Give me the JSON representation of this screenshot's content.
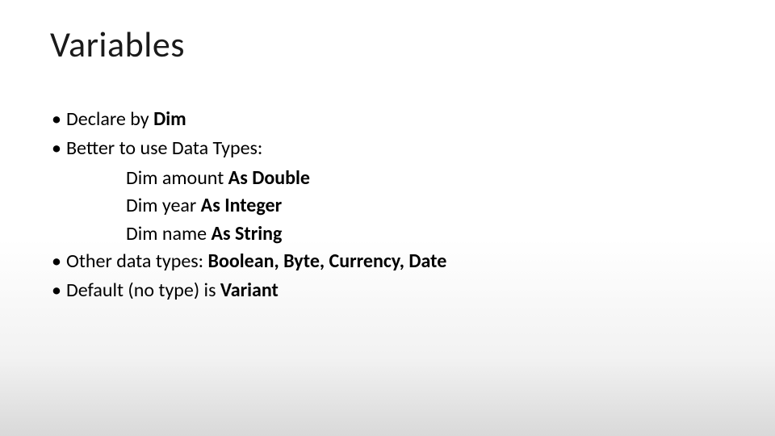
{
  "title": "Variables",
  "bullets": {
    "b1_pre": "Declare by ",
    "b1_bold": "Dim",
    "b2": "Better to use Data Types:",
    "b2_sub1_pre": "Dim amount ",
    "b2_sub1_bold": "As Double",
    "b2_sub2_pre": "Dim year ",
    "b2_sub2_bold": "As Integer",
    "b2_sub3_pre": "Dim name ",
    "b2_sub3_bold": "As String",
    "b3_pre": "Other data types:  ",
    "b3_bold": "Boolean, Byte, Currency, Date",
    "b4_pre": "Default (no type) is ",
    "b4_bold": "Variant"
  },
  "dot": "•"
}
